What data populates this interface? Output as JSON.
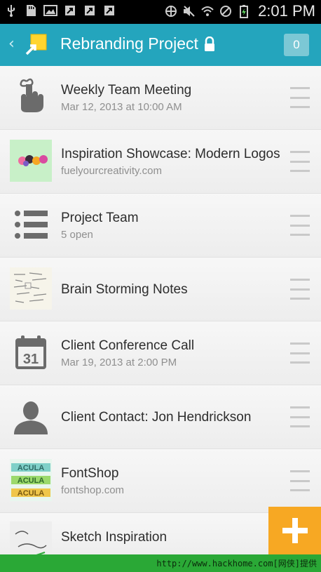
{
  "status_bar": {
    "time": "2:01 PM",
    "icons": [
      "usb-icon",
      "sd-card-icon",
      "image-icon",
      "sync-icon",
      "sync-icon",
      "sync-icon",
      "data-sync-icon",
      "mute-icon",
      "wifi-icon",
      "no-signal-icon",
      "battery-charging-icon"
    ]
  },
  "app_bar": {
    "title": "Rebranding Project",
    "badge_count": "0",
    "accent_color": "#24a5bd"
  },
  "items": [
    {
      "title": "Weekly Team Meeting",
      "subtitle": "Mar 12, 2013 at 10:00 AM",
      "icon": "reminder-finger-icon"
    },
    {
      "title": "Inspiration Showcase: Modern Logos",
      "subtitle": "fuelyourcreativity.com",
      "icon": "link-thumbnail"
    },
    {
      "title": "Project Team",
      "subtitle": "5 open",
      "icon": "list-icon"
    },
    {
      "title": "Brain Storming Notes",
      "subtitle": "",
      "icon": "notes-thumbnail"
    },
    {
      "title": "Client Conference Call",
      "subtitle": "Mar 19, 2013 at 2:00 PM",
      "icon": "calendar-icon",
      "calendar_day": "31"
    },
    {
      "title": "Client Contact: Jon Hendrickson",
      "subtitle": "",
      "icon": "person-icon"
    },
    {
      "title": "FontShop",
      "subtitle": "fontshop.com",
      "icon": "link-thumbnail"
    },
    {
      "title": "Sketch Inspiration",
      "subtitle": "",
      "icon": "sketch-thumbnail"
    }
  ],
  "fab": {
    "label": "+",
    "color": "#f7a823"
  },
  "footer": {
    "text": "http://www.hackhome.com[网侠]提供"
  }
}
